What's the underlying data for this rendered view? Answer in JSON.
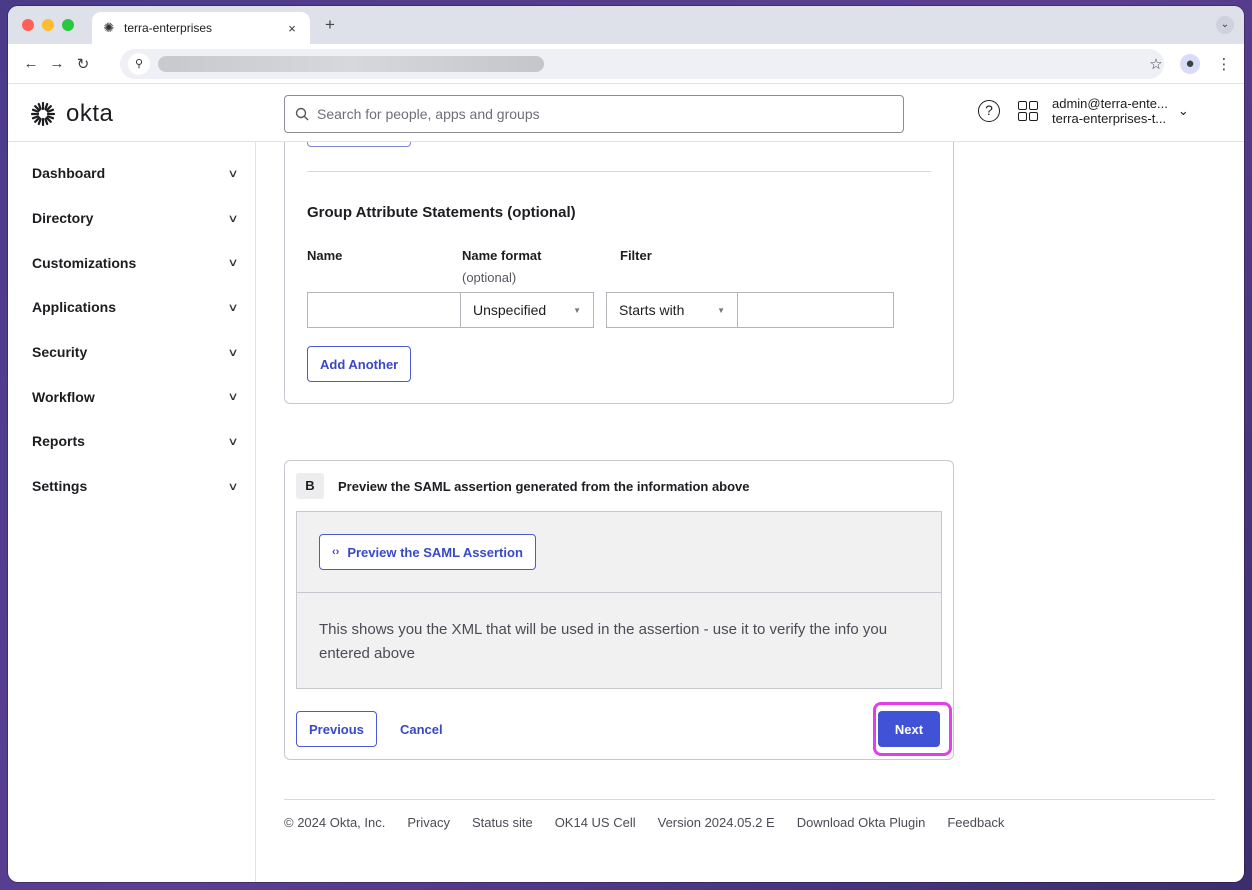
{
  "browser": {
    "tab_title": "terra-enterprises",
    "tab_close": "×",
    "new_tab": "+",
    "tab_list": "⌄"
  },
  "okta": {
    "logo_text": "okta",
    "search_placeholder": "Search for people, apps and groups",
    "account_email": "admin@terra-ente...",
    "account_org": "terra-enterprises-t..."
  },
  "sidebar": {
    "items": [
      {
        "label": "Dashboard"
      },
      {
        "label": "Directory"
      },
      {
        "label": "Customizations"
      },
      {
        "label": "Applications"
      },
      {
        "label": "Security"
      },
      {
        "label": "Workflow"
      },
      {
        "label": "Reports"
      },
      {
        "label": "Settings"
      }
    ]
  },
  "group_attributes": {
    "title": "Group Attribute Statements (optional)",
    "col_name": "Name",
    "col_name_format": "Name format",
    "col_name_format_sub": "(optional)",
    "col_filter": "Filter",
    "name_value": "",
    "name_format_value": "Unspecified",
    "filter_type_value": "Starts with",
    "filter_value": "",
    "add_another_label": "Add Another"
  },
  "section_b": {
    "badge": "B",
    "title": "Preview the SAML assertion generated from the information above",
    "preview_button_label": "Preview the SAML Assertion",
    "description": "This shows you the XML that will be used in the assertion - use it to verify the info you entered above"
  },
  "actions": {
    "previous_label": "Previous",
    "cancel_label": "Cancel",
    "next_label": "Next"
  },
  "footer": {
    "items": [
      "© 2024 Okta, Inc.",
      "Privacy",
      "Status site",
      "OK14 US Cell",
      "Version 2024.05.2 E",
      "Download Okta Plugin",
      "Feedback"
    ]
  },
  "colors": {
    "accent": "#4052d6",
    "highlight": "#e040e8"
  }
}
